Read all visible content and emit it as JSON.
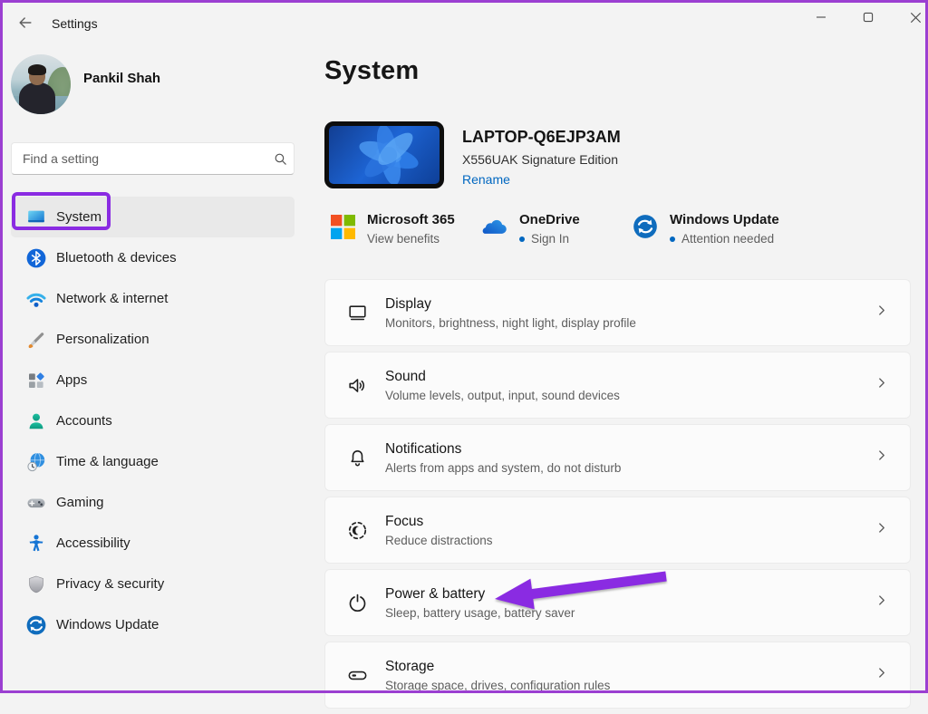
{
  "window": {
    "title": "Settings",
    "controls": {
      "minimize": "minimize",
      "maximize": "maximize",
      "close": "close"
    }
  },
  "profile": {
    "name": "Pankil Shah"
  },
  "search": {
    "placeholder": "Find a setting"
  },
  "sidebar": {
    "items": [
      {
        "label": "System",
        "selected": true
      },
      {
        "label": "Bluetooth & devices",
        "selected": false
      },
      {
        "label": "Network & internet",
        "selected": false
      },
      {
        "label": "Personalization",
        "selected": false
      },
      {
        "label": "Apps",
        "selected": false
      },
      {
        "label": "Accounts",
        "selected": false
      },
      {
        "label": "Time & language",
        "selected": false
      },
      {
        "label": "Gaming",
        "selected": false
      },
      {
        "label": "Accessibility",
        "selected": false
      },
      {
        "label": "Privacy & security",
        "selected": false
      },
      {
        "label": "Windows Update",
        "selected": false
      }
    ]
  },
  "main": {
    "title": "System",
    "device": {
      "name": "LAPTOP-Q6EJP3AM",
      "model": "X556UAK Signature Edition",
      "rename_label": "Rename"
    },
    "services": [
      {
        "name": "Microsoft 365",
        "status": "View benefits",
        "indicator": false
      },
      {
        "name": "OneDrive",
        "status": "Sign In",
        "indicator": true
      },
      {
        "name": "Windows Update",
        "status": "Attention needed",
        "indicator": true
      }
    ],
    "cards": [
      {
        "title": "Display",
        "subtitle": "Monitors, brightness, night light, display profile"
      },
      {
        "title": "Sound",
        "subtitle": "Volume levels, output, input, sound devices"
      },
      {
        "title": "Notifications",
        "subtitle": "Alerts from apps and system, do not disturb"
      },
      {
        "title": "Focus",
        "subtitle": "Reduce distractions"
      },
      {
        "title": "Power & battery",
        "subtitle": "Sleep, battery usage, battery saver"
      },
      {
        "title": "Storage",
        "subtitle": "Storage space, drives, configuration rules"
      }
    ]
  },
  "annotations": {
    "highlight_color": "#8A2BE2",
    "frame_color": "#9B3FD1",
    "highlighted_nav_item": "System",
    "arrow_target": "Power & battery"
  },
  "colors": {
    "background": "#F3F3F3",
    "card_background": "#FBFBFB",
    "link_blue": "#0067C0",
    "status_dot": "#0067C0"
  }
}
